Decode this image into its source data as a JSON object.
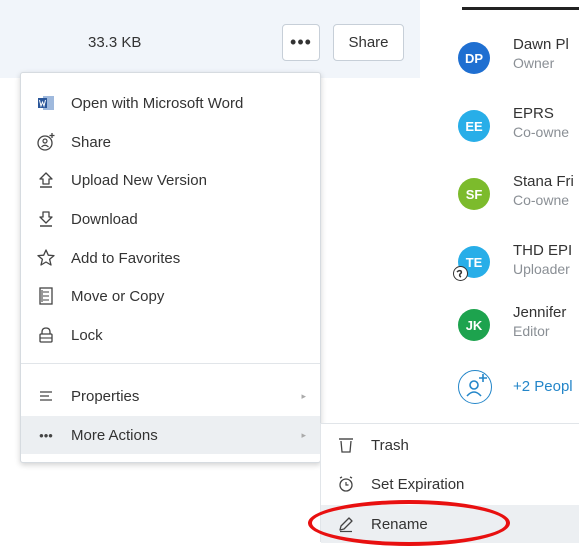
{
  "file_row": {
    "size": "33.3 KB",
    "more_button": "•••",
    "share_button": "Share"
  },
  "collaborators": [
    {
      "initials": "DP",
      "name": "Dawn Pl",
      "role": "Owner",
      "color": "#1f6fd1"
    },
    {
      "initials": "EE",
      "name": "EPRS",
      "role": "Co-owne",
      "color": "#28aee8"
    },
    {
      "initials": "SF",
      "name": "Stana Fri",
      "role": "Co-owne",
      "color": "#7cbb2c"
    },
    {
      "initials": "TE",
      "name": "THD EPI",
      "role": "Uploader",
      "color": "#28aee8"
    },
    {
      "initials": "JK",
      "name": "Jennifer",
      "role": "Editor",
      "color": "#1da34e"
    }
  ],
  "add_people": "+2 Peopl",
  "menu": {
    "items": [
      {
        "label": "Open with Microsoft Word",
        "icon": "word-icon"
      },
      {
        "label": "Share",
        "icon": "share-icon"
      },
      {
        "label": "Upload New Version",
        "icon": "upload-icon"
      },
      {
        "label": "Download",
        "icon": "download-icon"
      },
      {
        "label": "Add to Favorites",
        "icon": "star-icon"
      },
      {
        "label": "Move or Copy",
        "icon": "move-copy-icon"
      },
      {
        "label": "Lock",
        "icon": "lock-icon"
      },
      {
        "label": "Properties",
        "icon": "properties-icon"
      },
      {
        "label": "More Actions",
        "icon": "more-dots-icon"
      }
    ],
    "more_actions_glyph": "•••",
    "submenu_arrow": "▸"
  },
  "submenu": {
    "items": [
      {
        "label": "Trash",
        "icon": "trash-icon"
      },
      {
        "label": "Set Expiration",
        "icon": "clock-icon"
      },
      {
        "label": "Rename",
        "icon": "pencil-icon"
      }
    ]
  },
  "colors": {
    "accent": "#2486c9",
    "highlight_oval": "#e81010",
    "row_background": "#f1f5fa"
  }
}
